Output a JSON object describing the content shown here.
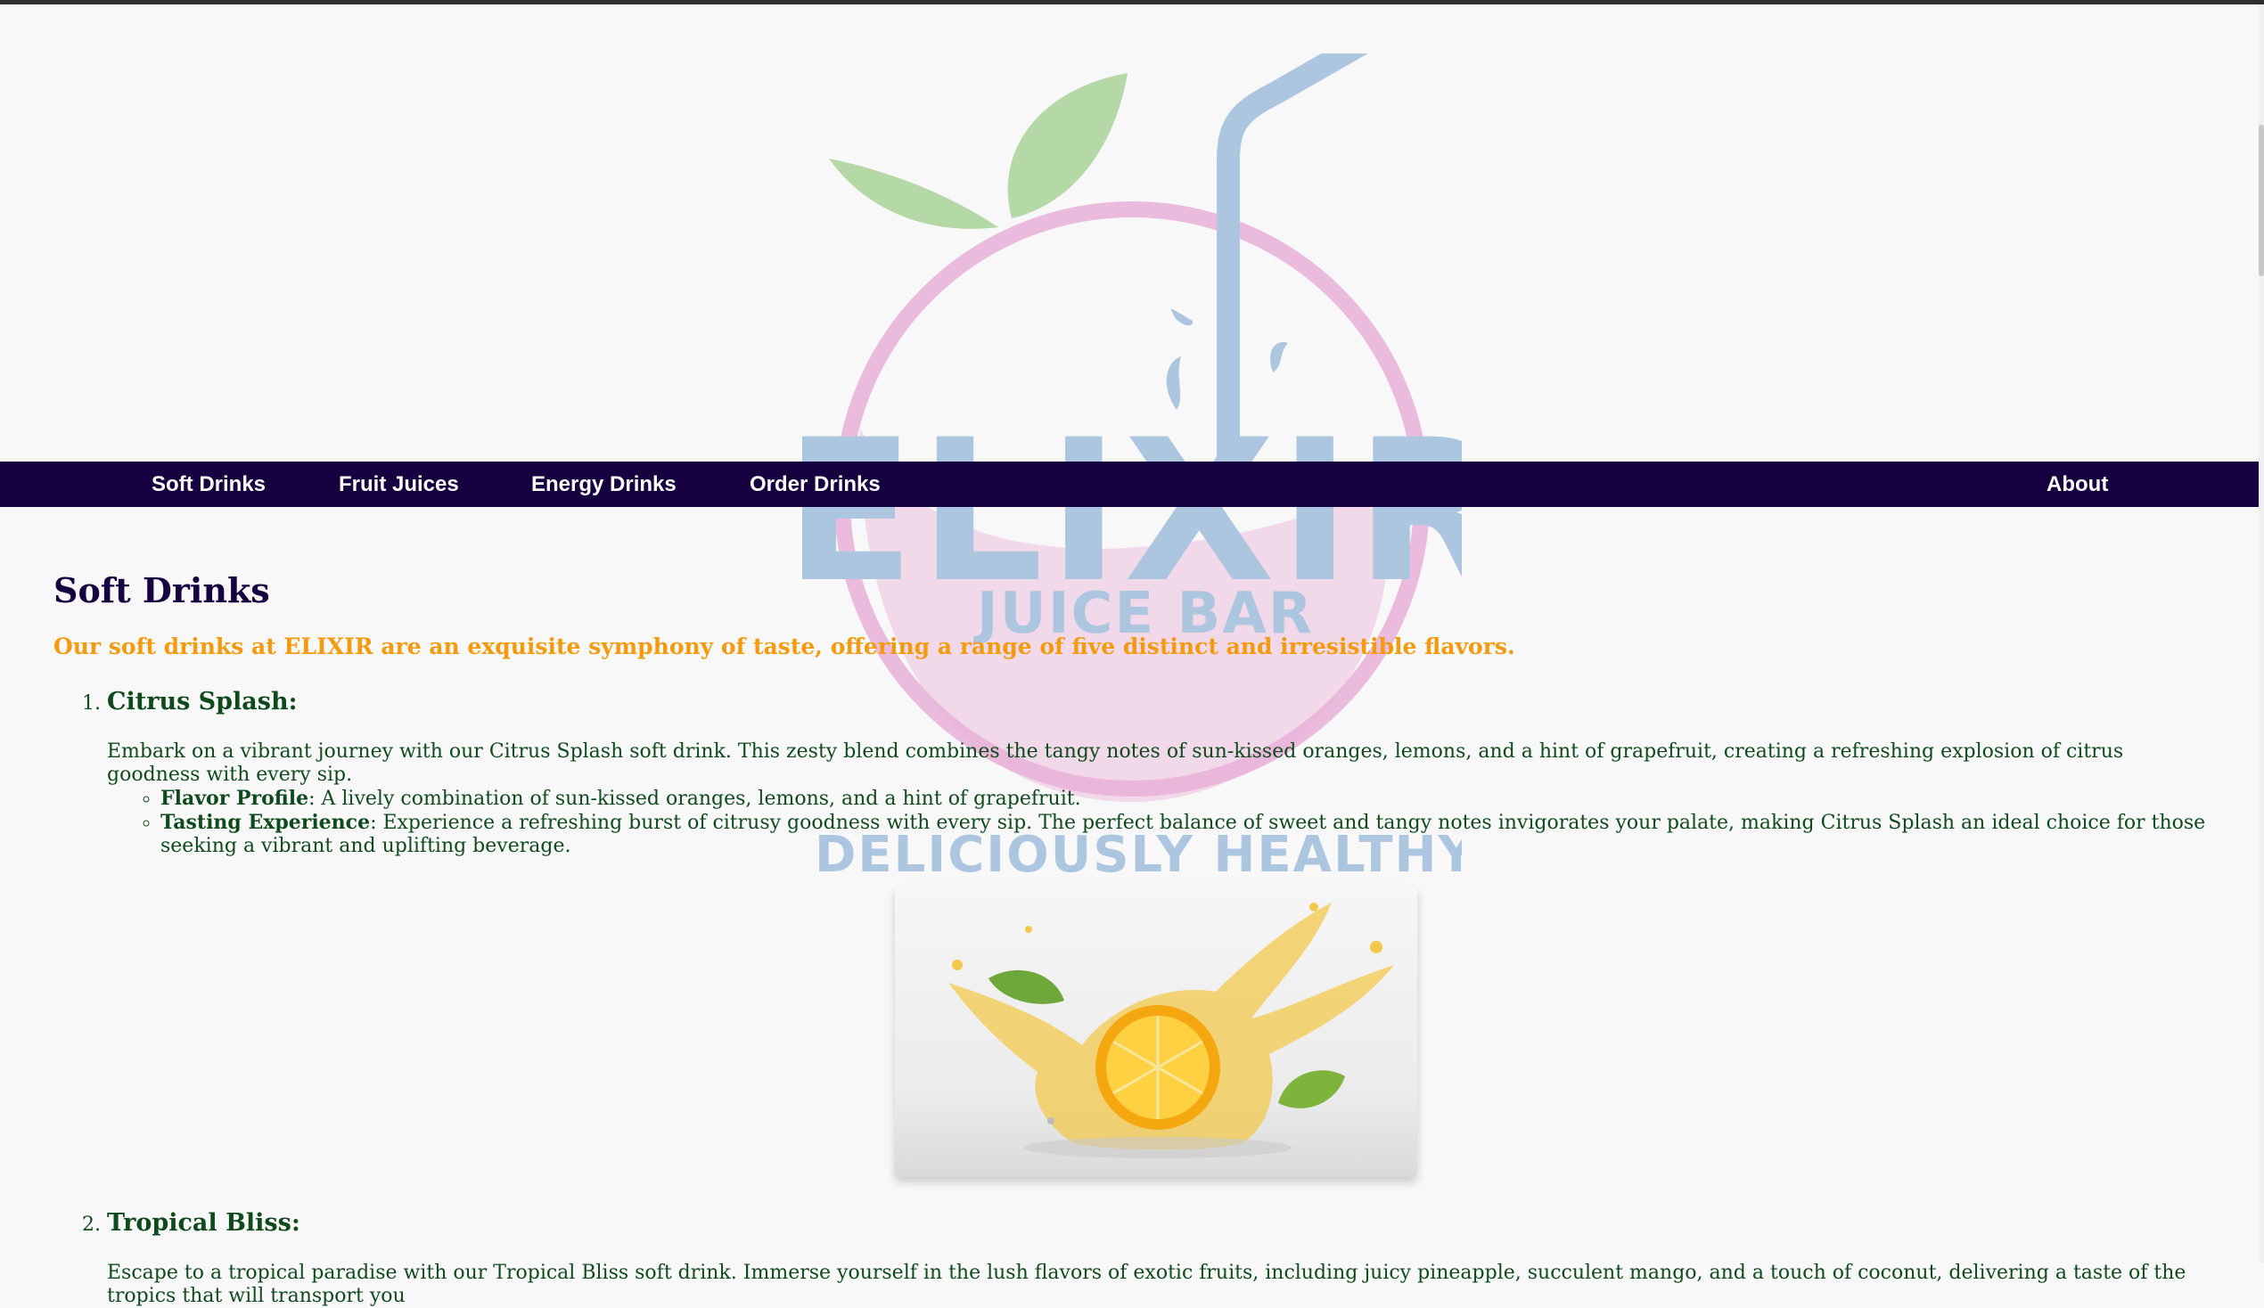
{
  "brand": {
    "logo_main": "ELIXIR",
    "logo_sub": "JUICE BAR",
    "logo_slogan": "DELICIOUSLY HEALTHY",
    "colors": {
      "leaf": "#b4d8a6",
      "fruit": "#e8b4d8",
      "straw": "#acc6e0"
    }
  },
  "nav": {
    "items": [
      {
        "label": "Soft Drinks"
      },
      {
        "label": "Fruit Juices"
      },
      {
        "label": "Energy Drinks"
      },
      {
        "label": "Order Drinks"
      }
    ],
    "about_label": "About",
    "background": "#160040"
  },
  "page": {
    "title": "Soft Drinks",
    "tagline": "Our soft drinks at ELIXIR are an exquisite symphony of taste, offering a range of five distinct and irresistible flavors."
  },
  "drinks": [
    {
      "name": "Citrus Splash:",
      "description": "Embark on a vibrant journey with our Citrus Splash soft drink. This zesty blend combines the tangy notes of sun-kissed oranges, lemons, and a hint of grapefruit, creating a refreshing explosion of citrus goodness with every sip.",
      "details": [
        {
          "label": "Flavor Profile",
          "text": ": A lively combination of sun-kissed oranges, lemons, and a hint of grapefruit."
        },
        {
          "label": "Tasting Experience",
          "text": ": Experience a refreshing burst of citrusy goodness with every sip. The perfect balance of sweet and tangy notes invigorates your palate, making Citrus Splash an ideal choice for those seeking a vibrant and uplifting beverage."
        }
      ],
      "image": "lemon-splash-image"
    },
    {
      "name": "Tropical Bliss:",
      "description": "Escape to a tropical paradise with our Tropical Bliss soft drink. Immerse yourself in the lush flavors of exotic fruits, including juicy pineapple, succulent mango, and a touch of coconut, delivering a taste of the tropics that will transport you"
    }
  ]
}
